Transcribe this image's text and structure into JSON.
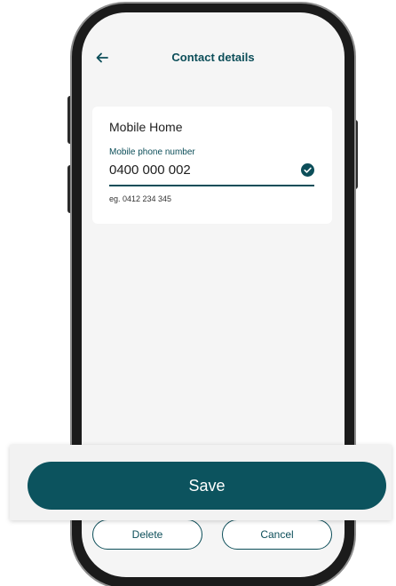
{
  "header": {
    "title": "Contact details",
    "back_icon": "arrow-left-icon"
  },
  "card": {
    "title": "Mobile Home",
    "field_label": "Mobile phone number",
    "field_value": "0400 000 002",
    "field_status_icon": "check-circle-icon",
    "helper_text": "eg. 0412 234 345"
  },
  "actions": {
    "save_label": "Save",
    "delete_label": "Delete",
    "cancel_label": "Cancel"
  },
  "colors": {
    "accent": "#0c4e59",
    "save_button": "#0c535e",
    "screen_background": "#f5f5f5",
    "card_background": "#ffffff"
  }
}
